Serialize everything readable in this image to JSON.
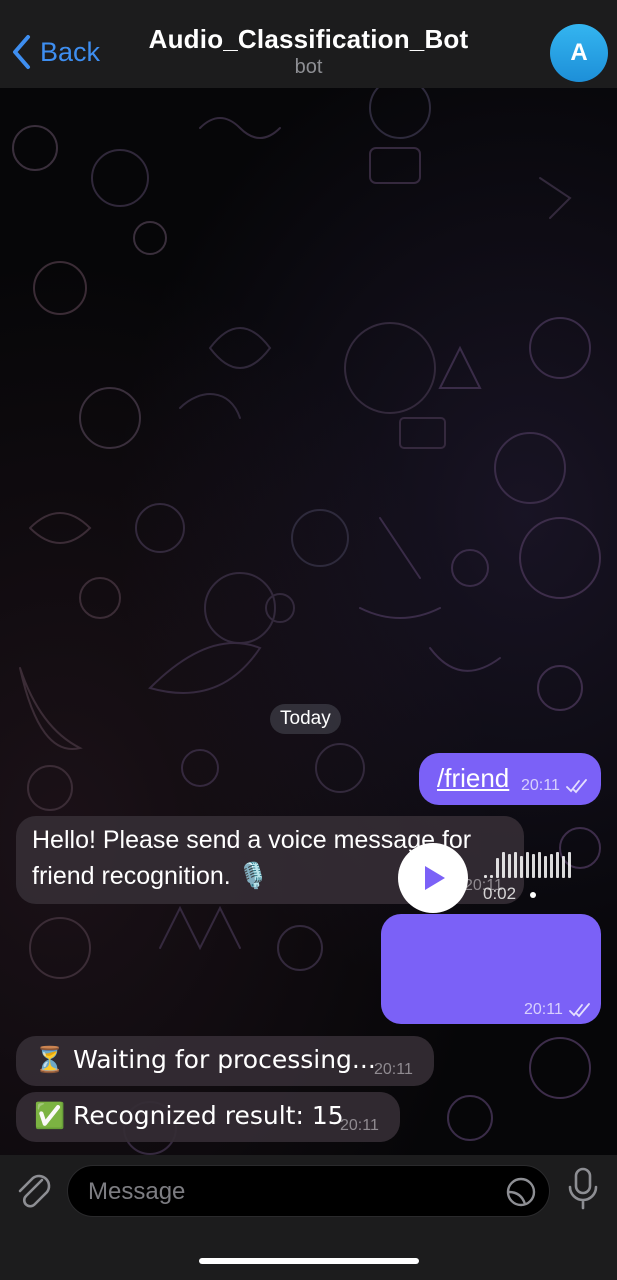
{
  "header": {
    "back_label": "Back",
    "title": "Audio_Classification_Bot",
    "subtitle": "bot",
    "avatar_letter": "A"
  },
  "chat": {
    "date_separator": "Today",
    "messages": [
      {
        "direction": "outgoing",
        "text": "/friend",
        "time": "20:11",
        "status": "read"
      },
      {
        "direction": "incoming",
        "text": "Hello! Please send a voice message for friend recognition. 🎙️",
        "time": "20:11"
      },
      {
        "direction": "outgoing",
        "type": "voice",
        "duration": "0:02",
        "time": "20:11",
        "status": "read"
      },
      {
        "direction": "incoming",
        "text": "⏳ Waiting for processing...",
        "time": "20:11"
      },
      {
        "direction": "incoming",
        "text": "✅ Recognized result: 15",
        "time": "20:11"
      }
    ]
  },
  "composer": {
    "placeholder": "Message",
    "attach_icon": "paperclip-icon",
    "sticker_icon": "sticker-icon",
    "mic_icon": "microphone-icon"
  },
  "colors": {
    "accent": "#3e8ef0",
    "outgoing_bubble": "#7b61f7",
    "incoming_bubble": "#342c34",
    "header_bg": "#1c1c1d"
  }
}
